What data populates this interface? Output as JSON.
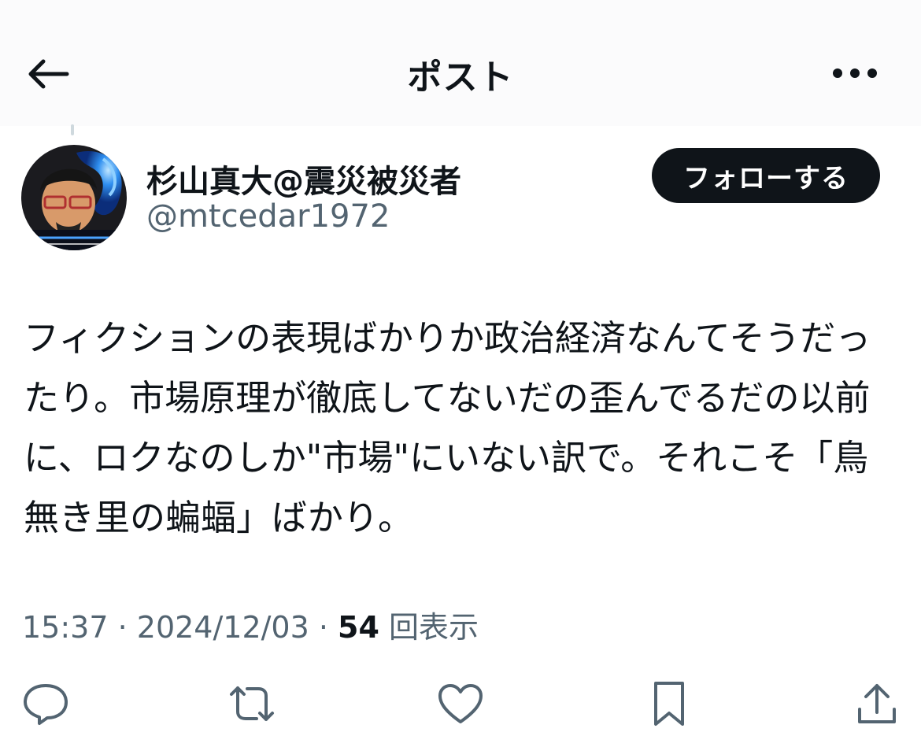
{
  "header": {
    "title": "ポスト",
    "back_icon": "arrow-left-icon",
    "more_icon": "more-horizontal-icon"
  },
  "author": {
    "display_name": "杉山真大@震災被災者",
    "handle": "@mtcedar1972",
    "follow_label": "フォローする"
  },
  "post": {
    "text": "フィクションの表現ばかりか政治経済なんてそうだったり。市場原理が徹底してないだの歪んでるだの以前に、ロクなのしか\"市場\"にいない訳で。それこそ「鳥無き里の蝙蝠」ばかり。"
  },
  "meta": {
    "time": "15:37",
    "sep1": " · ",
    "date": "2024/12/03",
    "sep2": " · ",
    "views_count": "54",
    "views_label": " 回表示"
  },
  "actions": {
    "reply_icon": "reply-icon",
    "repost_icon": "repost-icon",
    "like_icon": "like-heart-icon",
    "bookmark_icon": "bookmark-icon",
    "share_icon": "share-icon"
  },
  "colors": {
    "text_primary": "#0f1419",
    "text_secondary": "#536471",
    "follow_bg": "#0f1419",
    "header_bg": "#fbfbfc"
  }
}
